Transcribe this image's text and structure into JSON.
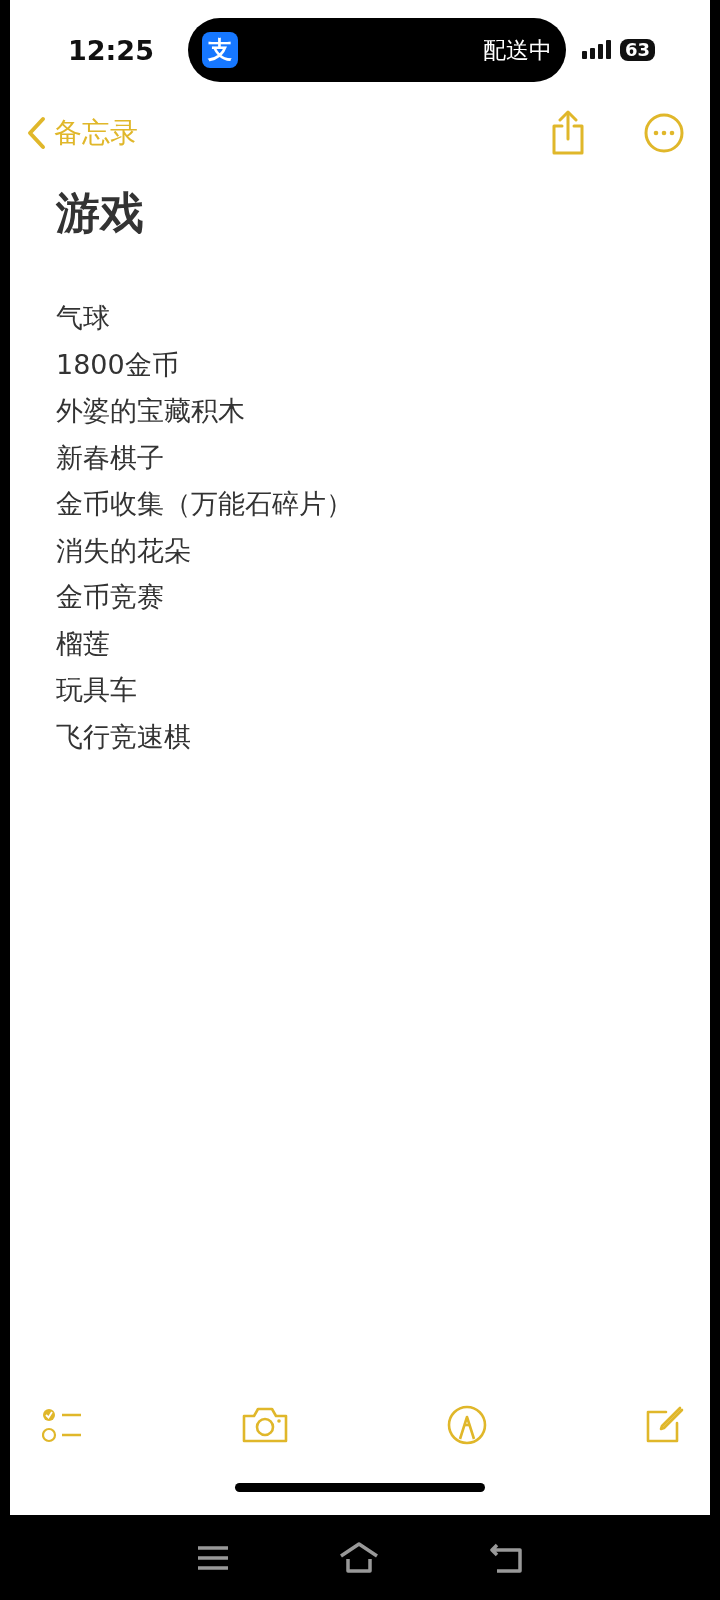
{
  "status_bar": {
    "time": "12:25",
    "live_activity": {
      "app_icon": "支",
      "status": "配送中"
    },
    "battery": "63"
  },
  "nav": {
    "back_label": "备忘录"
  },
  "note": {
    "title": "游戏",
    "lines": [
      "气球",
      "1800金币",
      "外婆的宝藏积木",
      "新春棋子",
      "金币收集（万能石碎片）",
      "消失的花朵",
      "金币竞赛",
      "榴莲",
      "玩具车",
      "飞行竞速棋"
    ]
  }
}
